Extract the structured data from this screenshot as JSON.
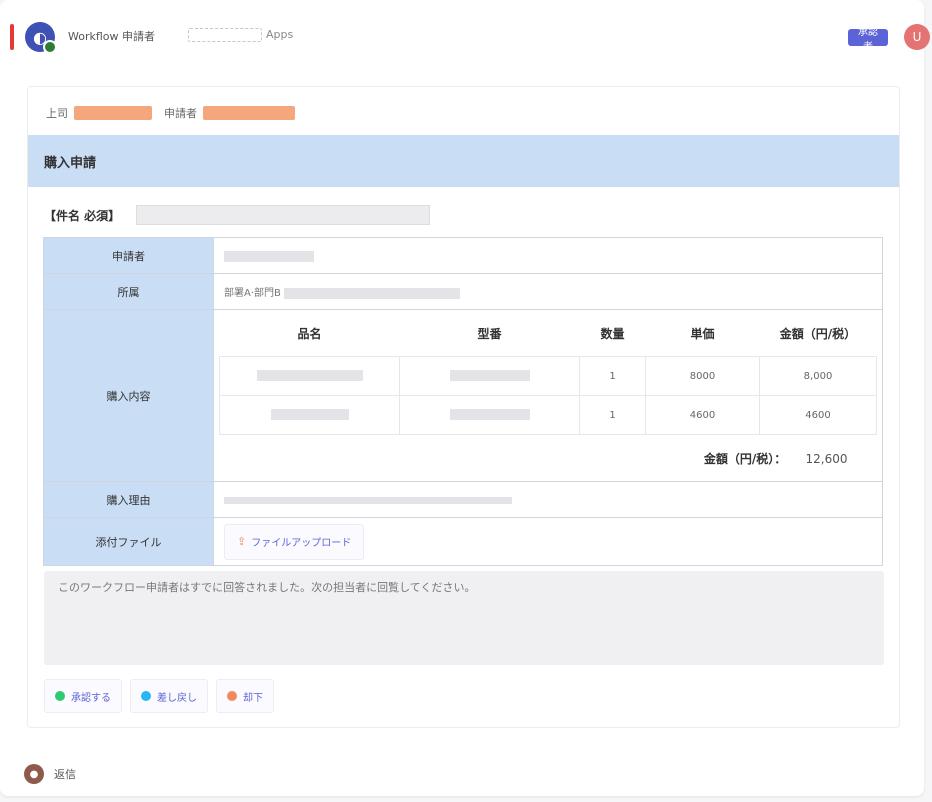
{
  "header": {
    "app_name": "Workflow 申請者",
    "app_sub_tail": "Apps",
    "tag_label": "承認者",
    "user_initial": "U",
    "app_glyph": "◐"
  },
  "meta": {
    "label_a": "上司",
    "label_b": "申請者"
  },
  "section": {
    "title": "購入申請"
  },
  "subject": {
    "label": "【件名 必須】"
  },
  "form": {
    "row1_label": "申請者",
    "row2_label": "所属",
    "row2_value": "部署A·部門B",
    "row3_label": "購入内容",
    "row4_label": "購入理由",
    "row5_label": "添付ファイル",
    "attach_label": "ファイルアップロード"
  },
  "items": {
    "headers": [
      "品名",
      "型番",
      "数量",
      "単価",
      "金額（円/税）"
    ],
    "rows": [
      {
        "qty": "1",
        "price": "8000",
        "amount": "8,000"
      },
      {
        "qty": "1",
        "price": "4600",
        "amount": "4600"
      }
    ],
    "total_label": "金額（円/税）：",
    "total_value": "12,600"
  },
  "notes": {
    "text": "このワークフロー申請者はすでに回答されました。次の担当者に回覧してください。"
  },
  "actions": [
    {
      "label": "承認する",
      "color": "#2ecc71"
    },
    {
      "label": "差し戻し",
      "color": "#29b6f6"
    },
    {
      "label": "却下",
      "color": "#f08a5d"
    }
  ],
  "footer": {
    "label": "返信",
    "avatar_glyph": "●"
  },
  "colors": {
    "accent": "#5c63d6",
    "section_bg": "#c9ddf5",
    "alert": "#e53935"
  }
}
